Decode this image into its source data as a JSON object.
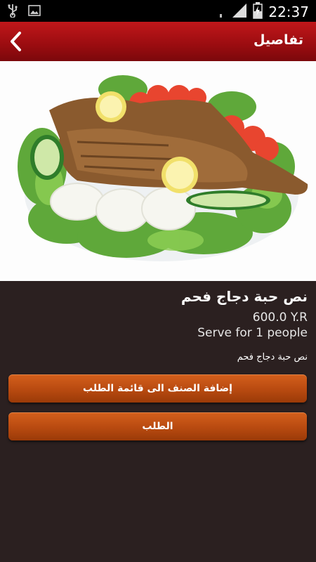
{
  "status_bar": {
    "time": "22:37",
    "icons": [
      "usb-icon",
      "image-icon",
      "wifi-icon",
      "signal-icon",
      "battery-charging-icon"
    ]
  },
  "app_bar": {
    "title": "تفاصيل",
    "back_icon": "chevron-left-icon"
  },
  "item": {
    "image": "grilled-chicken-plate",
    "name": "نص حبة دجاج فحم",
    "price": "600.0 Y.R",
    "serve": "Serve for 1 people",
    "description": "نص حبة دجاج فحم"
  },
  "actions": {
    "add_to_list_label": "إضافة الصنف الى قائمة الطلب",
    "order_label": "الطلب"
  },
  "colors": {
    "app_bar": "#b01216",
    "background": "#2b2020",
    "button": "#c4561a"
  }
}
